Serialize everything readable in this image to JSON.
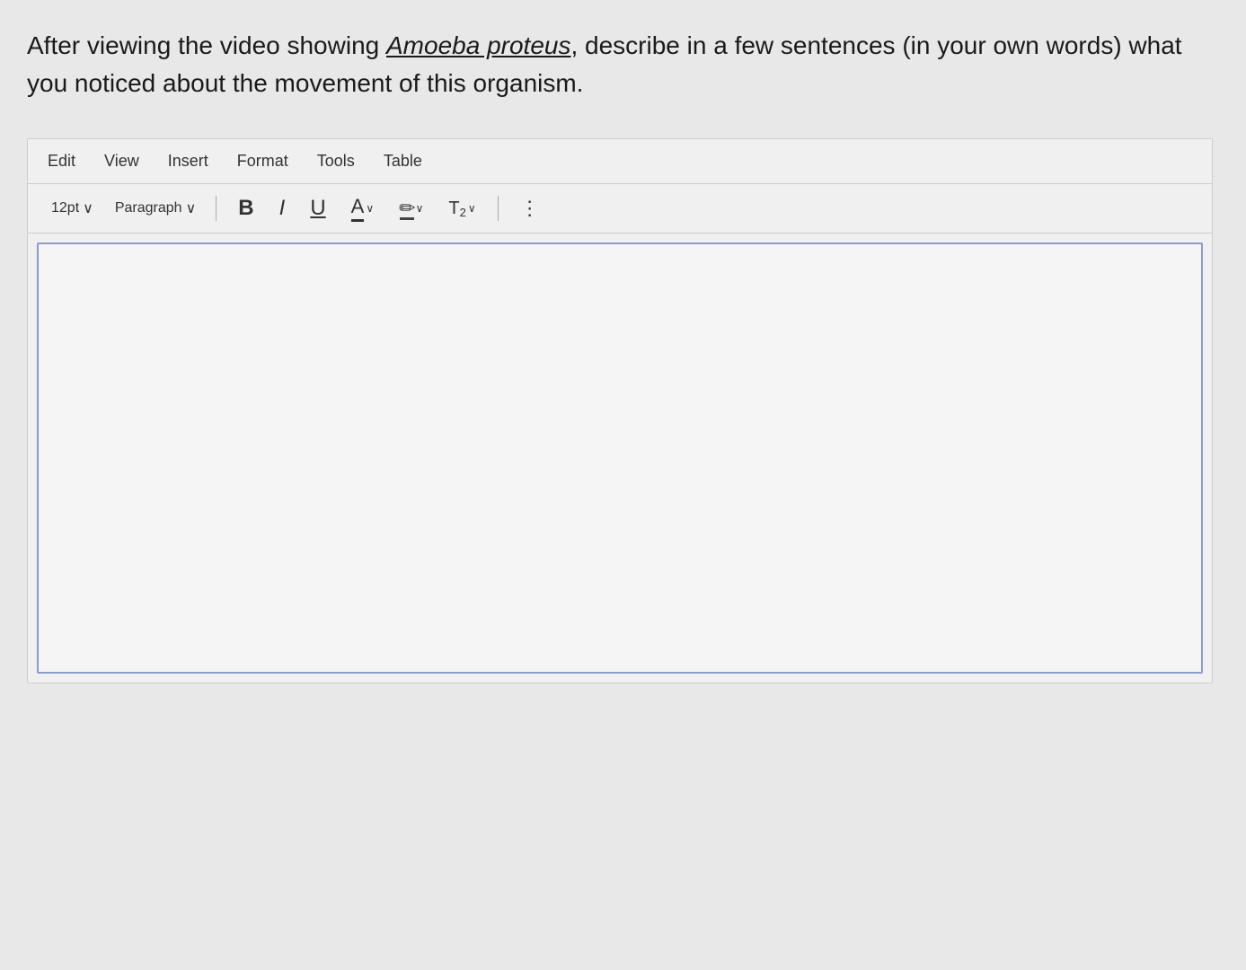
{
  "question": {
    "text_before_italic": "After viewing the video showing ",
    "italic_text": "Amoeba proteus",
    "text_after_italic": ", describe in a few sentences (in your own words) what you noticed about the movement of this organism."
  },
  "menu": {
    "items": [
      "Edit",
      "View",
      "Insert",
      "Format",
      "Tools",
      "Table"
    ]
  },
  "toolbar": {
    "font_size": "12pt",
    "font_size_chevron": "∨",
    "paragraph": "Paragraph",
    "paragraph_chevron": "∨",
    "bold_label": "B",
    "italic_label": "I",
    "underline_label": "U",
    "font_color_label": "A",
    "font_color_chevron": "∨",
    "highlight_chevron": "∨",
    "superscript_label": "T²",
    "superscript_chevron": "∨",
    "more_label": "⋮"
  },
  "editor": {
    "placeholder": ""
  }
}
